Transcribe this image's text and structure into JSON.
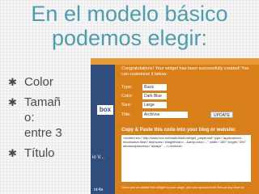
{
  "slide": {
    "title_line1": "En el modelo básico",
    "title_line2": "podemos elegir:",
    "bullets": [
      {
        "line1": "Color",
        "line2": "",
        "line3": ""
      },
      {
        "line1": "Tamañ",
        "line2": "o:",
        "line3": "entre 3"
      },
      {
        "line1": "Título",
        "line2": "",
        "line3": ""
      }
    ],
    "bullet_symbol": "✱"
  },
  "screenshot": {
    "congrats": "Congratulations! Your widget has been successfully created! You can customize it below:",
    "type_label": "Type:",
    "type_value": "Basic",
    "color_label": "Color:",
    "color_value": "Dark Blue",
    "size_label": "Size:",
    "size_value": "Large",
    "title_label": "Title:",
    "title_value": "Archivos",
    "update_label": "UPDATE",
    "copy_label": "Copy & Paste this code into your blog or website:",
    "code": "<embed src=\"http://www.box.net/static/flash/widget_player.swf\" type=\"application/x-shockwave-flash\" flashvars=\"widgetHash=...&amp;color=...\" width=\"160\" height=\"200\" allowscriptaccess=\"always\" ...></embed>",
    "footer": "Once you've added this widget to your page, you can upload more files at any time by",
    "left_box": "box",
    "left_more": "io V...",
    "left_ok": "nt:4a"
  },
  "colors": {
    "title": "#4d9db0",
    "bullet_text": "#4a4a4a",
    "screenshot_bg": "#d97f19",
    "screenshot_strip": "#2f4e7c"
  }
}
